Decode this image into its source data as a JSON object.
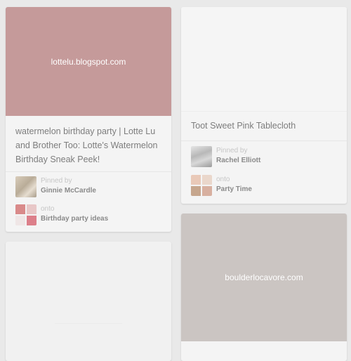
{
  "pins": [
    {
      "image_text": "lottelu.blogspot.com",
      "description": "watermelon birthday party | Lotte Lu and Brother Too: Lotte's Watermelon Birthday Sneak Peek!",
      "pinned_by_label": "Pinned by",
      "pinner": "Ginnie McCardle",
      "onto_label": "onto",
      "board": "Birthday party ideas",
      "image_color": "#c59a9a"
    },
    {
      "description": "Toot Sweet Pink Tablecloth",
      "pinned_by_label": "Pinned by",
      "pinner": "Rachel Elliott",
      "onto_label": "onto",
      "board": "Party Time"
    },
    {
      "image_text": "boulderlocavore.com",
      "image_color": "#cbc5c2"
    }
  ],
  "colors": {
    "background": "#e9e9e9",
    "card": "#f4f4f4",
    "text": "#7d7d7d",
    "muted": "#c6c6c6"
  }
}
